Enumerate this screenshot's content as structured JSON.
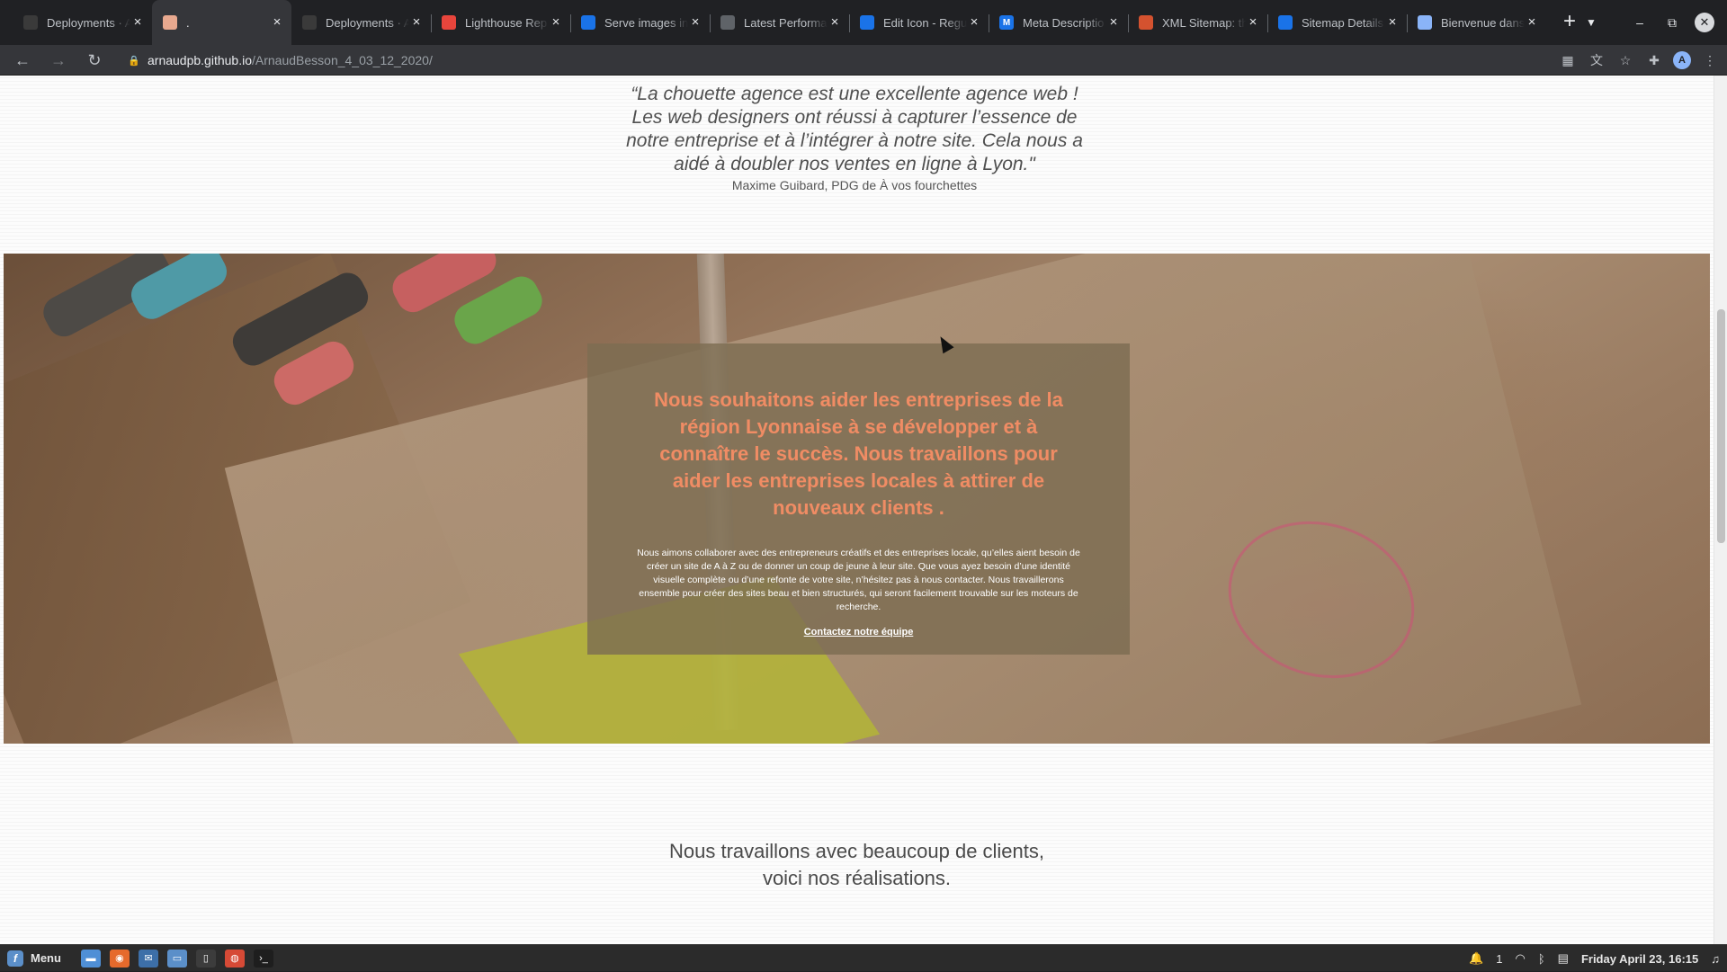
{
  "browser": {
    "tabs": [
      {
        "title": "Deployments · A",
        "fav_color": "#3a3a3a",
        "fav_glyph": "",
        "active": false
      },
      {
        "title": ".",
        "fav_color": "#e8a98f",
        "fav_glyph": "",
        "active": true
      },
      {
        "title": "Deployments · A",
        "fav_color": "#3a3a3a",
        "fav_glyph": "",
        "active": false
      },
      {
        "title": "Lighthouse Rep",
        "fav_color": "#e8453c",
        "fav_glyph": "",
        "active": false
      },
      {
        "title": "Serve images in",
        "fav_color": "#1a73e8",
        "fav_glyph": "",
        "active": false
      },
      {
        "title": "Latest Performa",
        "fav_color": "#5f6368",
        "fav_glyph": "",
        "active": false
      },
      {
        "title": "Edit Icon - Regu",
        "fav_color": "#1a73e8",
        "fav_glyph": "",
        "active": false
      },
      {
        "title": "Meta Descriptio",
        "fav_color": "#1a73e8",
        "fav_glyph": "M",
        "active": false
      },
      {
        "title": "XML Sitemap: th",
        "fav_color": "#d4522f",
        "fav_glyph": "",
        "active": false
      },
      {
        "title": "Sitemap Details",
        "fav_color": "#1a73e8",
        "fav_glyph": "",
        "active": false
      },
      {
        "title": "Bienvenue dans",
        "fav_color": "#8ab4f8",
        "fav_glyph": "",
        "active": false
      }
    ],
    "url_host": "arnaudpb.github.io",
    "url_path": "/ArnaudBesson_4_03_12_2020/",
    "profile_initial": "A"
  },
  "page": {
    "quote": "“La chouette agence est une excellente agence web ! Les web designers ont réussi à capturer l’essence de notre entreprise et à l’intégrer à notre site. Cela nous a aidé à doubler nos ventes en ligne à Lyon.\"",
    "author": "Maxime Guibard, PDG de À vos fourchettes",
    "hero_title": "Nous souhaitons aider les entreprises de la région Lyonnaise à se développer et à connaître le succès. Nous travaillons pour aider les entreprises locales à attirer de nouveaux clients .",
    "hero_text": "Nous aimons collaborer avec des entrepreneurs créatifs et des entreprises locale, qu’elles aient besoin de créer un site de A à Z ou de donner un coup de jeune à leur site. Que vous ayez besoin d’une identité visuelle complète ou d’une refonte de votre site, n’hésitez pas à nous contacter. Nous travaillerons ensemble pour créer des sites beau et bien structurés, qui seront facilement trouvable sur les moteurs de recherche.",
    "hero_link": "Contactez notre équipe",
    "section_line1": "Nous travaillons avec beaucoup de clients,",
    "section_line2": "voici nos réalisations."
  },
  "taskbar": {
    "menu_label": "Menu",
    "notifications": "1",
    "clock": "Friday April 23, 16:15"
  },
  "colors": {
    "hero_title": "#f08c64",
    "hero_box": "#7d6c52"
  }
}
